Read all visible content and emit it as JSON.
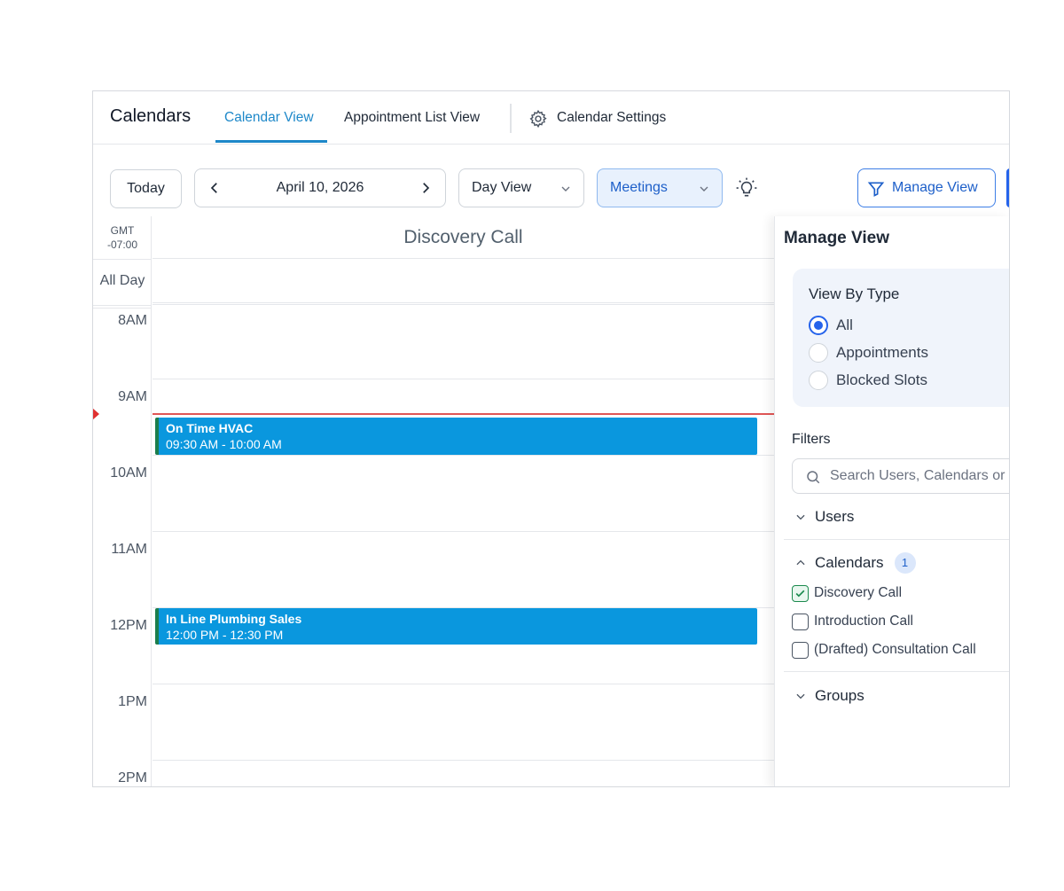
{
  "app": {
    "title": "Calendars",
    "tabs": [
      "Calendar View",
      "Appointment List View",
      "Calendar Settings"
    ],
    "active_tab": "Calendar View"
  },
  "toolbar": {
    "today_label": "Today",
    "date_label": "April 10, 2026",
    "view_label": "Day View",
    "type_label": "Meetings",
    "manage_view_label": "Manage View"
  },
  "calendar": {
    "timezone_line1": "GMT",
    "timezone_line2": "-07:00",
    "column_title": "Discovery Call",
    "all_day_label": "All Day",
    "hours": [
      "8AM",
      "9AM",
      "10AM",
      "11AM",
      "12PM",
      "1PM",
      "2PM"
    ],
    "events": [
      {
        "name": "On Time HVAC",
        "time": "09:30 AM - 10:00 AM"
      },
      {
        "name": "In Line Plumbing Sales",
        "time": "12:00 PM - 12:30 PM"
      }
    ]
  },
  "manage_view": {
    "title": "Manage View",
    "view_by_type_title": "View By Type",
    "types": [
      "All",
      "Appointments",
      "Blocked Slots"
    ],
    "selected_type": "All",
    "filters_title": "Filters",
    "search_placeholder": "Search Users, Calendars or Groups",
    "users_label": "Users",
    "calendars_label": "Calendars",
    "calendars_count": "1",
    "calendars": [
      {
        "label": "Discovery Call",
        "checked": true
      },
      {
        "label": "Introduction Call",
        "checked": false
      },
      {
        "label": "(Drafted) Consultation Call",
        "checked": false
      }
    ],
    "groups_label": "Groups"
  },
  "colors": {
    "accent": "#1e88c9",
    "primary": "#2563eb",
    "event": "#0a97de",
    "event_border": "#1b7d4d",
    "now_line": "#e05656"
  }
}
